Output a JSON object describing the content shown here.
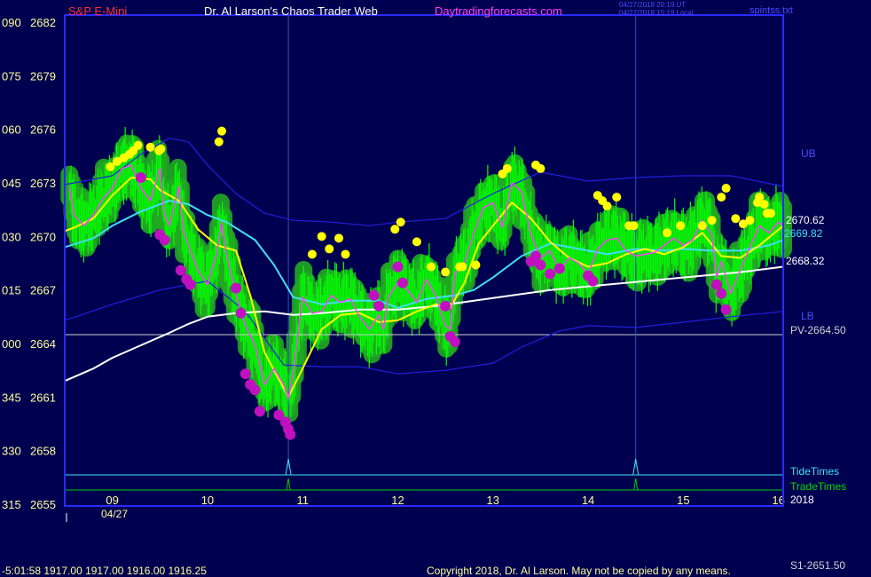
{
  "header": {
    "symbol": "S&P E-Mini",
    "title": "Dr. Al Larson's Chaos Trader Web",
    "site": "Daytradingforecasts.com",
    "timestamp_ut": "04/27/2018 20:19 UT",
    "timestamp_local": "04/27/2018 15:19 Local",
    "file": "spintss.txt"
  },
  "footer": {
    "status_line": "-5:01:58  1917.00 1917.00 1916.00 1916.25",
    "copyright": "Copyright 2018, Dr. Al Larson. May not be copied by any means.",
    "s1_label": "S1-2651.50"
  },
  "colors": {
    "background": "#000050",
    "frame": "#2a2aff",
    "band": "#2020e0",
    "ema_fast": "#ffff00",
    "ema_mid": "#40e0f0",
    "ema_slow": "#ffffff",
    "price_line": "#ff40ff",
    "bar_halo": "#22aa22",
    "bar": "#00ff00",
    "high_dot": "#ffff00",
    "low_dot": "#c010c0",
    "tide": "#40e0f0",
    "trade": "#00cc00",
    "pivot": "#d0d0d0",
    "labels": "#ffff99"
  },
  "chart_data": {
    "type": "line",
    "instrument": "S&P E-Mini",
    "date": "04/27",
    "year_label": "2018",
    "ylim": [
      2655,
      2682
    ],
    "xlim": [
      8.5,
      16.05
    ],
    "y_ticks": [
      {
        "deg": "090",
        "price": 2682
      },
      {
        "deg": "075",
        "price": 2679
      },
      {
        "deg": "060",
        "price": 2676
      },
      {
        "deg": "045",
        "price": 2673
      },
      {
        "deg": "030",
        "price": 2670
      },
      {
        "deg": "015",
        "price": 2667
      },
      {
        "deg": "000",
        "price": 2664
      },
      {
        "deg": "345",
        "price": 2661
      },
      {
        "deg": "330",
        "price": 2658
      },
      {
        "deg": "315",
        "price": 2655
      }
    ],
    "x_ticks": [
      "09",
      "10",
      "11",
      "12",
      "13",
      "14",
      "15",
      "16"
    ],
    "pivot": {
      "label": "PV-2664.50",
      "value": 2664.5
    },
    "band_labels": {
      "upper": "UB",
      "lower": "LB"
    },
    "last_values": [
      {
        "label": "2670.62",
        "value": 2670.62,
        "color": "#ffffff"
      },
      {
        "label": "2669.82",
        "value": 2669.82,
        "color": "#40e0f0"
      },
      {
        "label": "2668.32",
        "value": 2668.32,
        "color": "#ffffff"
      }
    ],
    "timing_lines": [
      {
        "name": "TideTimes",
        "times": [
          10.85,
          14.5
        ]
      },
      {
        "name": "TradeTimes",
        "times": [
          10.85,
          14.5
        ]
      }
    ],
    "series": [
      {
        "name": "Upper band",
        "role": "band",
        "x": [
          8.5,
          9.0,
          9.3,
          9.6,
          9.8,
          10.0,
          10.3,
          10.6,
          10.9,
          11.3,
          11.7,
          12.0,
          12.5,
          13.0,
          13.5,
          14.0,
          14.5,
          15.0,
          15.5,
          16.05
        ],
        "y": [
          2672.9,
          2673.4,
          2674.6,
          2675.5,
          2675.3,
          2674.0,
          2672.4,
          2671.3,
          2670.9,
          2670.8,
          2670.6,
          2670.8,
          2671.0,
          2672.4,
          2673.6,
          2673.1,
          2673.3,
          2673.4,
          2673.4,
          2672.8
        ]
      },
      {
        "name": "Lower band",
        "role": "band",
        "x": [
          8.5,
          9.0,
          9.5,
          10.0,
          10.4,
          10.8,
          11.2,
          11.6,
          12.0,
          12.5,
          13.0,
          13.3,
          13.7,
          14.0,
          14.5,
          15.0,
          15.5,
          16.05
        ],
        "y": [
          2665.3,
          2666.2,
          2667.0,
          2667.5,
          2665.8,
          2662.8,
          2662.7,
          2662.7,
          2662.3,
          2662.5,
          2662.9,
          2663.8,
          2664.7,
          2665.0,
          2664.9,
          2665.2,
          2665.5,
          2665.8
        ]
      },
      {
        "name": "EMA mid",
        "role": "ema_mid",
        "x": [
          8.5,
          8.8,
          9.0,
          9.3,
          9.6,
          9.8,
          10.0,
          10.2,
          10.5,
          10.7,
          10.9,
          11.2,
          11.5,
          11.8,
          12.0,
          12.3,
          12.6,
          12.8,
          13.0,
          13.3,
          13.6,
          13.9,
          14.2,
          14.5,
          14.8,
          15.0,
          15.3,
          15.6,
          15.9,
          16.05
        ],
        "y": [
          2669.4,
          2669.9,
          2670.6,
          2671.4,
          2672.0,
          2671.8,
          2671.2,
          2670.8,
          2669.8,
          2668.4,
          2666.6,
          2666.2,
          2666.4,
          2666.4,
          2666.0,
          2666.5,
          2666.7,
          2667.0,
          2667.7,
          2668.9,
          2669.6,
          2669.3,
          2669.0,
          2669.3,
          2669.2,
          2669.3,
          2669.2,
          2669.2,
          2669.5,
          2669.8
        ]
      },
      {
        "name": "EMA slow",
        "role": "ema_slow",
        "x": [
          8.5,
          8.8,
          9.0,
          9.3,
          9.6,
          9.8,
          10.0,
          10.3,
          10.6,
          10.9,
          11.2,
          11.6,
          12.0,
          12.4,
          12.8,
          13.2,
          13.6,
          14.0,
          14.4,
          14.8,
          15.2,
          15.6,
          16.05
        ],
        "y": [
          2661.9,
          2662.6,
          2663.2,
          2663.9,
          2664.6,
          2665.1,
          2665.5,
          2665.7,
          2665.8,
          2665.6,
          2665.7,
          2665.9,
          2665.9,
          2666.1,
          2666.4,
          2666.7,
          2667.0,
          2667.2,
          2667.4,
          2667.6,
          2667.8,
          2668.0,
          2668.3
        ]
      },
      {
        "name": "EMA fast",
        "role": "ema_fast",
        "x": [
          8.5,
          8.6,
          8.8,
          9.0,
          9.2,
          9.4,
          9.5,
          9.7,
          9.9,
          10.1,
          10.3,
          10.45,
          10.6,
          10.75,
          10.85,
          11.0,
          11.2,
          11.4,
          11.6,
          11.8,
          12.0,
          12.2,
          12.4,
          12.55,
          12.7,
          12.85,
          13.0,
          13.2,
          13.4,
          13.6,
          13.8,
          14.0,
          14.2,
          14.4,
          14.6,
          14.8,
          15.0,
          15.2,
          15.4,
          15.6,
          15.8,
          16.05
        ],
        "y": [
          2670.3,
          2670.5,
          2671.0,
          2672.3,
          2673.3,
          2673.2,
          2672.6,
          2672.0,
          2670.4,
          2669.5,
          2669.2,
          2666.7,
          2663.5,
          2662.0,
          2661.0,
          2662.6,
          2664.8,
          2665.6,
          2665.7,
          2665.2,
          2665.3,
          2665.8,
          2666.2,
          2666.0,
          2667.4,
          2669.6,
          2670.6,
          2671.9,
          2671.0,
          2669.7,
          2668.8,
          2668.3,
          2668.5,
          2669.0,
          2669.3,
          2669.0,
          2669.4,
          2670.2,
          2668.9,
          2668.8,
          2669.5,
          2670.6
        ]
      },
      {
        "name": "Price",
        "role": "price",
        "x": [
          8.55,
          8.6,
          8.7,
          8.8,
          8.9,
          9.0,
          9.1,
          9.2,
          9.3,
          9.4,
          9.5,
          9.55,
          9.6,
          9.7,
          9.75,
          9.8,
          9.9,
          10.0,
          10.1,
          10.15,
          10.2,
          10.3,
          10.4,
          10.5,
          10.6,
          10.7,
          10.8,
          10.85,
          10.9,
          11.0,
          11.1,
          11.2,
          11.3,
          11.4,
          11.5,
          11.6,
          11.7,
          11.8,
          11.85,
          11.9,
          12.0,
          12.1,
          12.2,
          12.3,
          12.4,
          12.5,
          12.55,
          12.6,
          12.7,
          12.8,
          12.9,
          13.0,
          13.1,
          13.2,
          13.3,
          13.4,
          13.5,
          13.6,
          13.7,
          13.8,
          13.9,
          14.0,
          14.1,
          14.2,
          14.3,
          14.4,
          14.5,
          14.6,
          14.7,
          14.8,
          14.9,
          15.0,
          15.1,
          15.2,
          15.3,
          15.35,
          15.4,
          15.5,
          15.6,
          15.7,
          15.8,
          15.9,
          16.0,
          16.05
        ],
        "y": [
          2672.8,
          2671.2,
          2670.6,
          2671.2,
          2672.1,
          2672.7,
          2673.8,
          2674.0,
          2672.7,
          2672.0,
          2673.8,
          2671.2,
          2670.6,
          2672.8,
          2670.3,
          2669.5,
          2668.1,
          2667.3,
          2669.1,
          2670.8,
          2669.0,
          2666.7,
          2665.0,
          2663.9,
          2661.7,
          2662.6,
          2661.7,
          2660.9,
          2662.3,
          2666.6,
          2665.7,
          2665.8,
          2666.7,
          2666.3,
          2666.5,
          2665.5,
          2664.8,
          2665.6,
          2664.8,
          2666.6,
          2667.4,
          2667.0,
          2666.3,
          2667.6,
          2666.7,
          2665.0,
          2664.8,
          2667.9,
          2668.5,
          2670.2,
          2671.6,
          2671.9,
          2670.5,
          2673.0,
          2672.5,
          2670.1,
          2668.8,
          2669.2,
          2668.1,
          2668.8,
          2668.5,
          2667.9,
          2669.3,
          2669.8,
          2669.9,
          2669.2,
          2668.9,
          2669.0,
          2669.1,
          2669.5,
          2669.9,
          2669.5,
          2669.8,
          2670.9,
          2670.1,
          2667.7,
          2668.6,
          2666.8,
          2668.1,
          2669.4,
          2670.6,
          2670.2,
          2670.8,
          2670.6
        ]
      }
    ],
    "high_markers": {
      "x": [
        8.98,
        9.05,
        9.12,
        9.18,
        9.22,
        9.27,
        9.4,
        9.49,
        9.51,
        10.12,
        10.15,
        11.1,
        11.2,
        11.28,
        11.38,
        11.45,
        11.97,
        12.03,
        12.2,
        12.35,
        12.5,
        12.65,
        12.68,
        12.82,
        13.1,
        13.15,
        13.45,
        13.5,
        14.1,
        14.15,
        14.2,
        14.3,
        14.43,
        14.48,
        14.83,
        14.97,
        15.2,
        15.3,
        15.4,
        15.45,
        15.55,
        15.63,
        15.7,
        15.78,
        15.8,
        15.85,
        15.88,
        15.92
      ],
      "y": [
        2673.9,
        2674.2,
        2674.4,
        2674.6,
        2674.8,
        2675.1,
        2675.0,
        2674.8,
        2674.9,
        2675.3,
        2675.9,
        2669.0,
        2670.0,
        2669.3,
        2669.9,
        2669.0,
        2670.4,
        2670.8,
        2669.7,
        2668.3,
        2668.0,
        2668.3,
        2668.3,
        2668.4,
        2673.5,
        2673.8,
        2674.0,
        2673.8,
        2672.3,
        2672.0,
        2671.7,
        2672.2,
        2670.6,
        2670.6,
        2670.2,
        2670.6,
        2670.6,
        2670.9,
        2672.2,
        2672.7,
        2671.0,
        2670.7,
        2670.9,
        2671.9,
        2672.2,
        2671.8,
        2671.3,
        2671.3
      ],
      "radius": 5
    },
    "low_markers": {
      "x": [
        9.3,
        9.5,
        9.55,
        9.72,
        9.78,
        9.82,
        10.3,
        10.35,
        10.4,
        10.45,
        10.5,
        10.55,
        10.75,
        10.82,
        10.85,
        10.87,
        11.75,
        11.8,
        12.0,
        12.05,
        12.5,
        12.55,
        12.6,
        13.4,
        13.45,
        13.5,
        13.6,
        13.7,
        14.0,
        14.05,
        15.35,
        15.4,
        15.45
      ],
      "y": [
        2673.3,
        2670.1,
        2669.8,
        2668.1,
        2667.6,
        2667.3,
        2667.1,
        2665.7,
        2662.3,
        2661.7,
        2661.4,
        2660.2,
        2660.0,
        2659.6,
        2659.2,
        2658.9,
        2666.7,
        2666.1,
        2668.3,
        2667.4,
        2666.1,
        2664.4,
        2664.1,
        2668.6,
        2668.9,
        2668.4,
        2667.9,
        2668.2,
        2667.8,
        2667.5,
        2667.3,
        2666.8,
        2665.9
      ],
      "radius": 6
    },
    "vertical_markers": [
      10.85,
      14.5
    ]
  }
}
